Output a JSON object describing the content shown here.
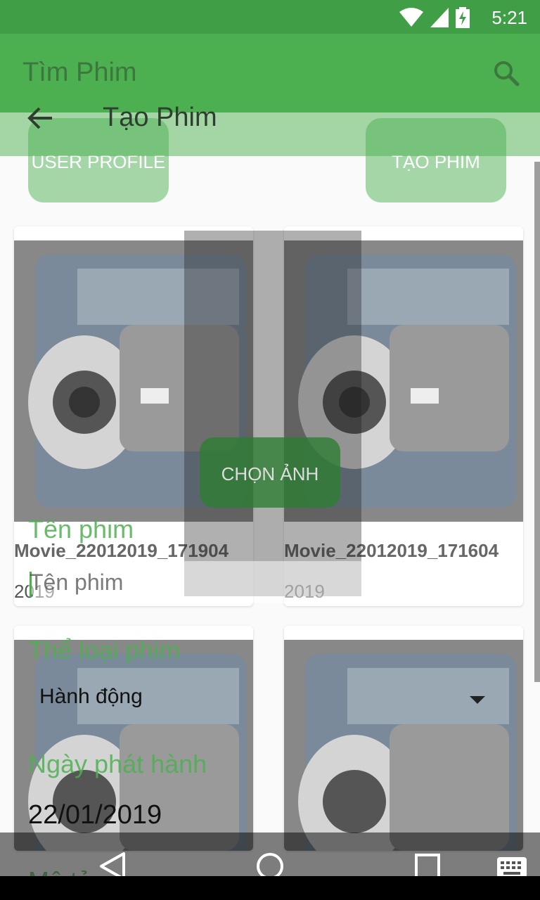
{
  "status_bar": {
    "time": "5:21"
  },
  "main_screen": {
    "title": "Tìm Phim",
    "user_profile_button": "USER PROFILE",
    "create_button": "TẠO PHIM",
    "movies": [
      {
        "name": "Movie_22012019_171904",
        "year": "2019"
      },
      {
        "name": "Movie_22012019_171604",
        "year": "2019"
      },
      {
        "name": "",
        "year": ""
      },
      {
        "name": "",
        "year": ""
      }
    ]
  },
  "create_screen": {
    "title": "Tạo Phim",
    "choose_image_button": "CHỌN ẢNH",
    "movie_name_label": "Tên phim",
    "movie_name_placeholder": "Tên phim",
    "genre_label": "Thể loại phim",
    "genre_selected": "Hành động",
    "release_label": "Ngày phát hành",
    "release_date": "22/01/2019",
    "description_label_partial": "Mô tả"
  },
  "colors": {
    "primary": "#4caf50",
    "status": "#3f9e46",
    "accent_dark": "#2e7d32"
  },
  "icons": [
    "wifi-icon",
    "signal-icon",
    "battery-charging-icon",
    "search-icon",
    "back-arrow-icon",
    "nav-back-icon",
    "nav-home-icon",
    "nav-recents-icon",
    "keyboard-icon"
  ]
}
